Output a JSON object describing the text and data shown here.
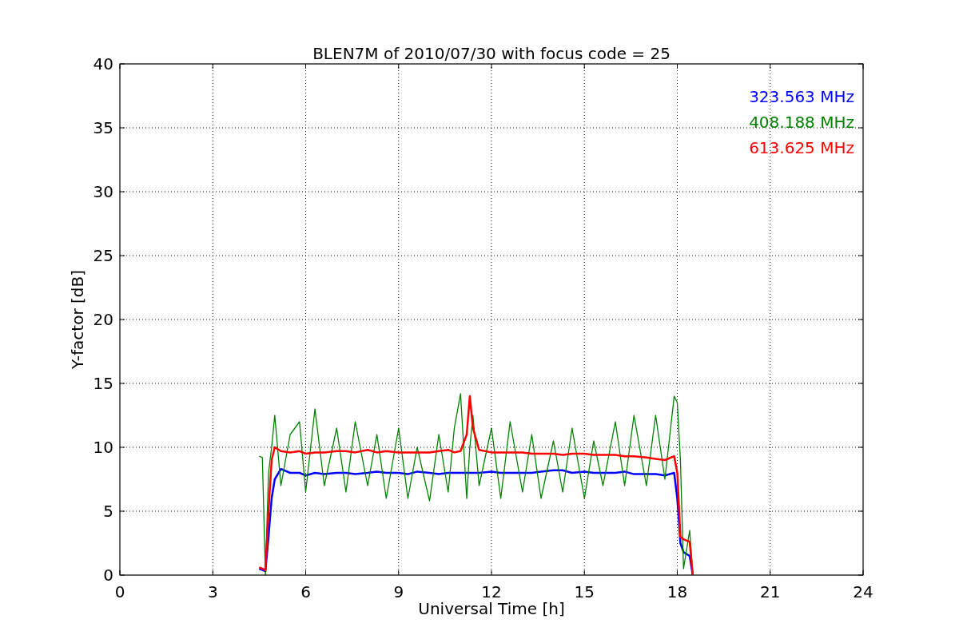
{
  "chart": {
    "chart_data": {
      "type": "line",
      "title": "BLEN7M of 2010/07/30 with focus code = 25",
      "xlabel": "Universal Time [h]",
      "ylabel": "Y-factor [dB]",
      "x": [
        4.5,
        4.6,
        4.7,
        4.8,
        4.9,
        5.0,
        5.2,
        5.5,
        5.8,
        6.0,
        6.3,
        6.6,
        7.0,
        7.3,
        7.6,
        8.0,
        8.3,
        8.6,
        9.0,
        9.3,
        9.6,
        10.0,
        10.3,
        10.6,
        10.8,
        11.0,
        11.2,
        11.3,
        11.4,
        11.6,
        12.0,
        12.3,
        12.6,
        13.0,
        13.3,
        13.6,
        14.0,
        14.3,
        14.6,
        15.0,
        15.3,
        15.6,
        16.0,
        16.3,
        16.6,
        17.0,
        17.3,
        17.6,
        17.9,
        18.0,
        18.1,
        18.2,
        18.4,
        18.5
      ],
      "series": [
        {
          "name": "323.563 MHz",
          "color": "#0000ff",
          "values": [
            0.5,
            0.4,
            0.3,
            3,
            6,
            7.5,
            8.3,
            8,
            8,
            7.8,
            8,
            7.9,
            8,
            8,
            7.9,
            8,
            8.1,
            8,
            8,
            7.9,
            8.1,
            8,
            7.9,
            8,
            8,
            8,
            8,
            8,
            8,
            8,
            8.1,
            8,
            8,
            8,
            8,
            8.1,
            8.2,
            8.2,
            8,
            8.1,
            8,
            8,
            8,
            8.1,
            7.9,
            7.9,
            7.9,
            7.8,
            8,
            6,
            2.5,
            1.8,
            1.5,
            0
          ]
        },
        {
          "name": "408.188 MHz",
          "color": "#008000",
          "values": [
            9.3,
            9.2,
            0,
            8,
            10,
            12.5,
            7,
            11,
            12,
            6.5,
            13,
            7,
            11.5,
            6.5,
            12,
            7,
            11,
            6,
            11.5,
            6,
            10,
            5.8,
            11,
            6.5,
            11.5,
            14.2,
            6,
            10,
            12.5,
            7,
            11.5,
            6,
            12,
            6.5,
            11,
            6,
            10.5,
            6.5,
            11.5,
            6,
            10.5,
            7,
            12,
            7,
            12.5,
            7,
            12.5,
            7.5,
            14,
            13.5,
            9,
            0.5,
            3.5,
            0
          ]
        },
        {
          "name": "613.625 MHz",
          "color": "#ff0000",
          "values": [
            0.6,
            0.5,
            0.4,
            5,
            9,
            10,
            9.7,
            9.6,
            9.7,
            9.5,
            9.6,
            9.6,
            9.7,
            9.7,
            9.6,
            9.8,
            9.6,
            9.7,
            9.6,
            9.6,
            9.6,
            9.6,
            9.7,
            9.8,
            9.6,
            9.7,
            11,
            14,
            11.5,
            9.8,
            9.6,
            9.6,
            9.6,
            9.6,
            9.5,
            9.5,
            9.5,
            9.4,
            9.5,
            9.5,
            9.4,
            9.4,
            9.4,
            9.3,
            9.3,
            9.2,
            9.1,
            9.0,
            9.3,
            8,
            3,
            2.8,
            2.6,
            0
          ]
        }
      ],
      "grid": true,
      "xlim": [
        0,
        24
      ],
      "ylim": [
        0,
        40
      ],
      "xticks": [
        0,
        3,
        6,
        9,
        12,
        15,
        18,
        21,
        24
      ],
      "yticks": [
        0,
        5,
        10,
        15,
        20,
        25,
        30,
        35,
        40
      ]
    }
  }
}
